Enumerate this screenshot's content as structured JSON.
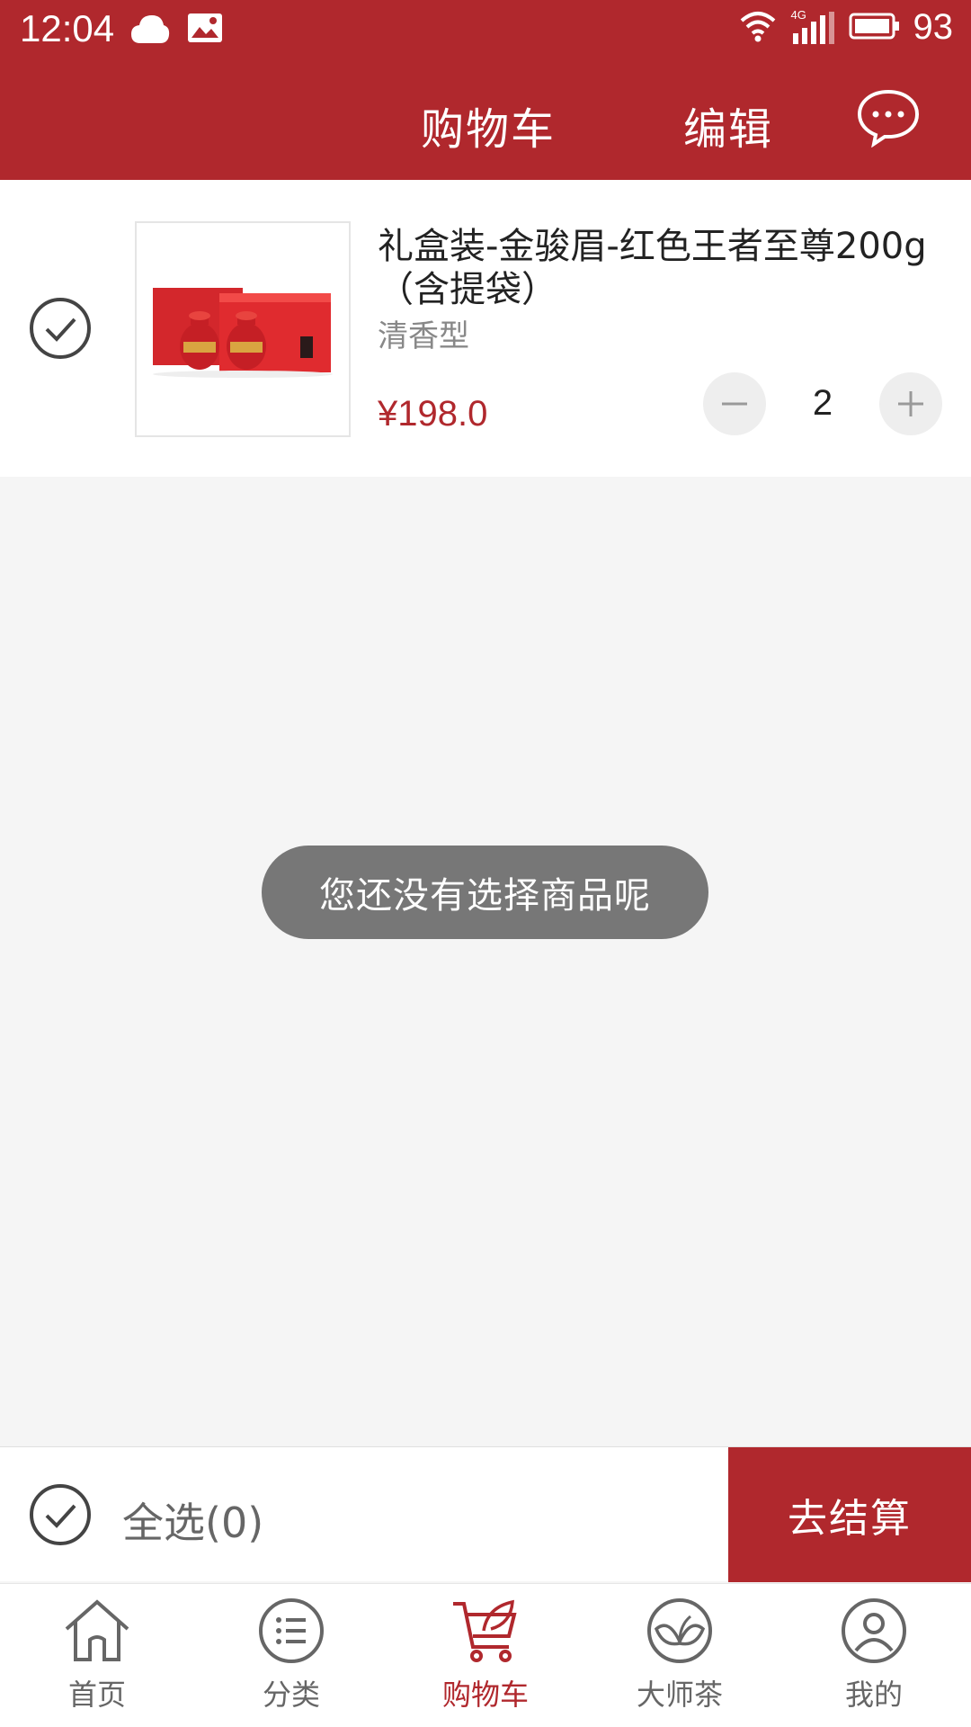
{
  "status_bar": {
    "time": "12:04",
    "network": "4G",
    "battery": "93"
  },
  "header": {
    "title": "购物车",
    "edit_label": "编辑"
  },
  "cart_item": {
    "name": "礼盒装-金骏眉-红色王者至尊200g（含提袋）",
    "spec": "清香型",
    "price": "¥198.0",
    "quantity": "2"
  },
  "toast": "您还没有选择商品呢",
  "footer": {
    "select_all": "全选(0)",
    "checkout": "去结算"
  },
  "tabs": [
    {
      "label": "首页",
      "icon": "home-icon"
    },
    {
      "label": "分类",
      "icon": "category-icon"
    },
    {
      "label": "购物车",
      "icon": "cart-icon"
    },
    {
      "label": "大师茶",
      "icon": "tea-leaf-icon"
    },
    {
      "label": "我的",
      "icon": "profile-icon"
    }
  ],
  "colors": {
    "brand": "#b0282d",
    "toast_bg": "#777777"
  }
}
